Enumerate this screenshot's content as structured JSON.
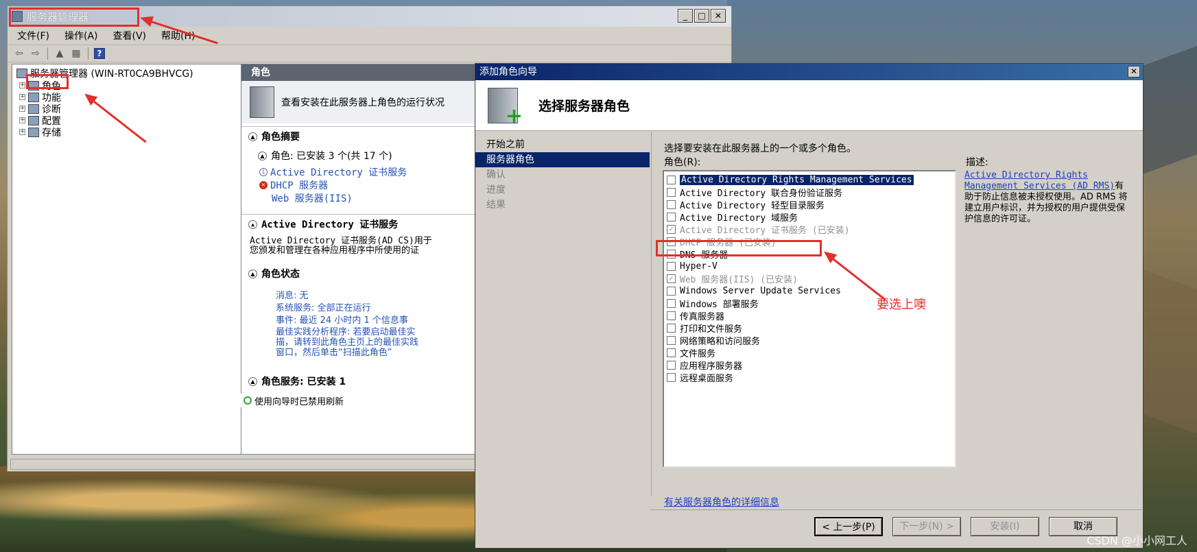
{
  "server_manager": {
    "title": "服务器管理器",
    "menu": [
      "文件(F)",
      "操作(A)",
      "查看(V)",
      "帮助(H)"
    ],
    "tree": {
      "root": "服务器管理器 (WIN-RT0CA9BHVCG)",
      "items": [
        "角色",
        "功能",
        "诊断",
        "配置",
        "存储"
      ]
    },
    "right": {
      "header": "角色",
      "intro": "查看安装在此服务器上角色的运行状况",
      "summary_title": "角色摘要",
      "roles_installed": "角色: 已安装 3 个(共 17 个)",
      "installed_roles": [
        "Active Directory 证书服务",
        "DHCP 服务器",
        "Web 服务器(IIS)"
      ],
      "adcs_title": "Active Directory 证书服务",
      "adcs_desc_1": "Active Directory 证书服务(AD CS)用于",
      "adcs_desc_2": "您颁发和管理在各种应用程序中所使用的证",
      "status_title": "角色状态",
      "status_lines": [
        "消息: 无",
        "系统服务: 全部正在运行",
        "事件: 最近 24 小时内 1 个信息事",
        "最佳实践分析程序: 若要启动最佳实",
        "描，请转到此角色主页上的最佳实践",
        "窗口，然后单击“扫描此角色”"
      ],
      "role_services": "角色服务: 已安装 1",
      "statusbar": "使用向导时已禁用刷新"
    }
  },
  "wizard": {
    "title": "添加角色向导",
    "header_title": "选择服务器角色",
    "nav": [
      "开始之前",
      "服务器角色",
      "确认",
      "进度",
      "结果"
    ],
    "instruction": "选择要安装在此服务器上的一个或多个角色。",
    "roles_label": "角色(R):",
    "description_label": "描述:",
    "roles": [
      {
        "label": "Active Directory Rights Management Services",
        "checked": false,
        "disabled": false
      },
      {
        "label": "Active Directory 联合身份验证服务",
        "checked": false,
        "disabled": false
      },
      {
        "label": "Active Directory 轻型目录服务",
        "checked": false,
        "disabled": false
      },
      {
        "label": "Active Directory 域服务",
        "checked": false,
        "disabled": false
      },
      {
        "label": "Active Directory 证书服务  (已安装)",
        "checked": true,
        "disabled": true
      },
      {
        "label": "DHCP 服务器  (已安装)",
        "checked": true,
        "disabled": true
      },
      {
        "label": "DNS 服务器",
        "checked": false,
        "disabled": false
      },
      {
        "label": "Hyper-V",
        "checked": false,
        "disabled": false
      },
      {
        "label": "Web 服务器(IIS)  (已安装)",
        "checked": true,
        "disabled": true
      },
      {
        "label": "Windows Server Update Services",
        "checked": false,
        "disabled": false
      },
      {
        "label": "Windows 部署服务",
        "checked": false,
        "disabled": false
      },
      {
        "label": "传真服务器",
        "checked": false,
        "disabled": false
      },
      {
        "label": "打印和文件服务",
        "checked": false,
        "disabled": false
      },
      {
        "label": "网络策略和访问服务",
        "checked": false,
        "disabled": false
      },
      {
        "label": "文件服务",
        "checked": false,
        "disabled": false
      },
      {
        "label": "应用程序服务器",
        "checked": false,
        "disabled": false
      },
      {
        "label": "远程桌面服务",
        "checked": false,
        "disabled": false
      }
    ],
    "description": {
      "link": "Active Directory Rights Management Services (AD RMS)",
      "text": "有助于防止信息被未授权使用。AD RMS 将建立用户标识，并为授权的用户提供受保护信息的许可证。"
    },
    "more_info": "有关服务器角色的详细信息",
    "buttons": {
      "back": "< 上一步(P)",
      "next": "下一步(N) >",
      "install": "安装(I)",
      "cancel": "取消"
    }
  },
  "annotation": {
    "text": "要选上噢",
    "color": "#e0302c"
  },
  "watermark": "CSDN @小小网工人"
}
